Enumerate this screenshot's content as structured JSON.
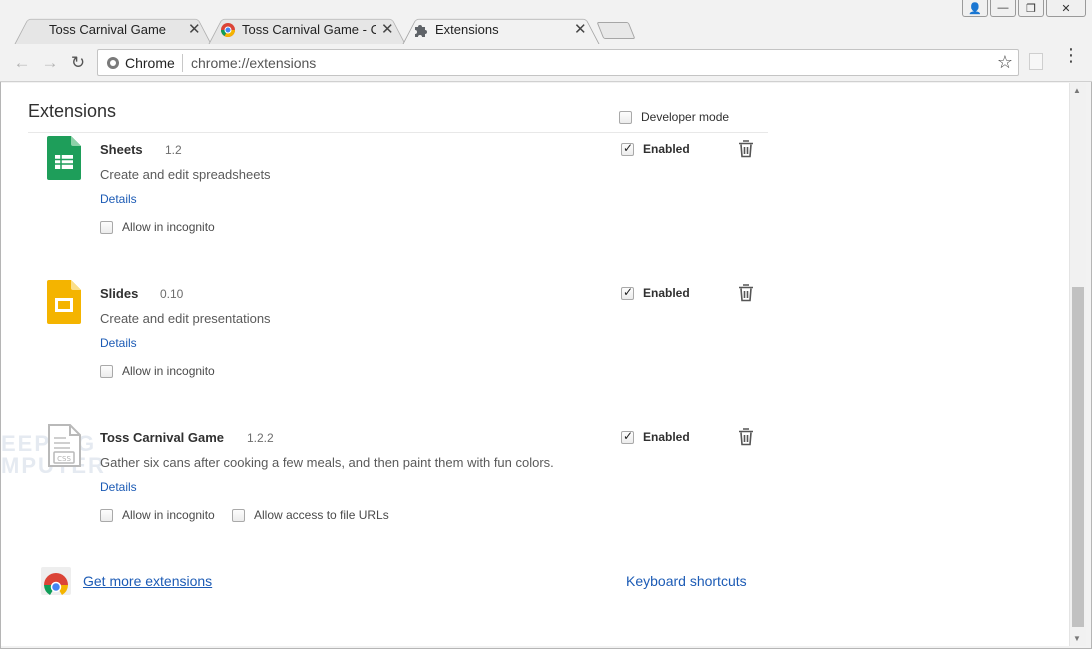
{
  "tabs": [
    {
      "title": "Toss Carnival Game",
      "close": "✕"
    },
    {
      "title": "Toss Carnival Game - Chr",
      "close": "✕"
    },
    {
      "title": "Extensions",
      "close": "✕"
    }
  ],
  "window_controls": {
    "user": "👤",
    "minimize": "—",
    "maximize": "❐",
    "close": "✕"
  },
  "toolbar": {
    "back": "←",
    "forward": "→",
    "reload": "↻",
    "star": "☆",
    "menu": "⋮"
  },
  "omnibox": {
    "origin": "Chrome",
    "url": "chrome://extensions"
  },
  "page": {
    "title": "Extensions",
    "developer_mode": "Developer mode"
  },
  "extensions": [
    {
      "name": "Sheets",
      "version": "1.2",
      "description": "Create and edit spreadsheets",
      "details": "Details",
      "incognito": "Allow in incognito",
      "enabled": "Enabled",
      "icon": "sheets-icon",
      "color": "#1e9e5a"
    },
    {
      "name": "Slides",
      "version": "0.10",
      "description": "Create and edit presentations",
      "details": "Details",
      "incognito": "Allow in incognito",
      "enabled": "Enabled",
      "icon": "slides-icon",
      "color": "#f4b400"
    },
    {
      "name": "Toss Carnival Game",
      "version": "1.2.2",
      "description": "Gather six cans after cooking a few meals, and then paint them with fun colors.",
      "details": "Details",
      "incognito": "Allow in incognito",
      "file_urls": "Allow access to file URLs",
      "enabled": "Enabled",
      "icon": "generic-extension-icon"
    }
  ],
  "watermark": [
    "EEPING",
    "MPUTER"
  ],
  "footer": {
    "get_more": "Get more extensions",
    "keyboard_shortcuts": "Keyboard shortcuts"
  }
}
